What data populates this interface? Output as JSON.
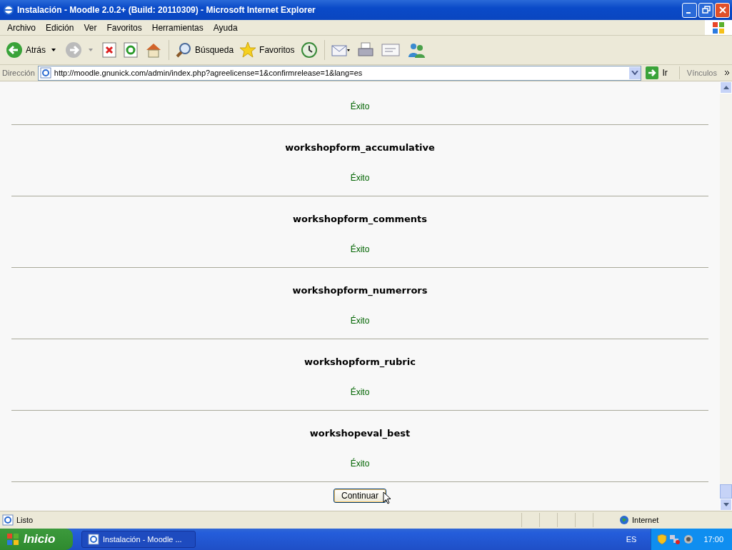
{
  "window": {
    "title": "Instalación - Moodle 2.0.2+ (Build: 20110309) - Microsoft Internet Explorer"
  },
  "menu": [
    "Archivo",
    "Edición",
    "Ver",
    "Favoritos",
    "Herramientas",
    "Ayuda"
  ],
  "toolbar": {
    "back": "Atrás",
    "search": "Búsqueda",
    "favorites": "Favoritos"
  },
  "address": {
    "label": "Dirección",
    "url": "http://moodle.gnunick.com/admin/index.php?agreelicense=1&confirmrelease=1&lang=es",
    "go": "Ir",
    "links": "Vínculos"
  },
  "first_status": "Éxito",
  "results": [
    {
      "name": "workshopform_accumulative",
      "status": "Éxito"
    },
    {
      "name": "workshopform_comments",
      "status": "Éxito"
    },
    {
      "name": "workshopform_numerrors",
      "status": "Éxito"
    },
    {
      "name": "workshopform_rubric",
      "status": "Éxito"
    },
    {
      "name": "workshopeval_best",
      "status": "Éxito"
    }
  ],
  "continue_button": "Continuar",
  "status_bar": {
    "text": "Listo",
    "zone": "Internet"
  },
  "taskbar": {
    "start": "Inicio",
    "task": "Instalación - Moodle ...",
    "language": "ES",
    "clock": "17:00"
  }
}
